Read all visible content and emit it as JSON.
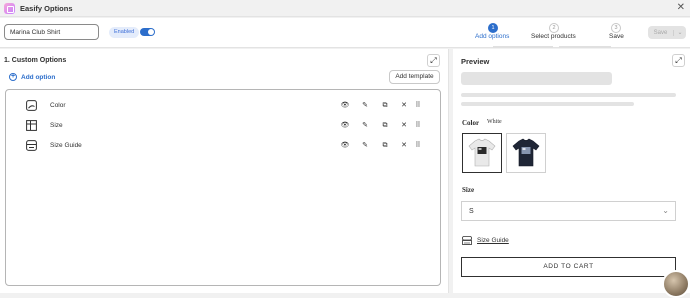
{
  "window": {
    "title": "Easify Options",
    "close_icon": "close-icon"
  },
  "header": {
    "name_value": "Marina Club Shirt",
    "enabled_label": "Enabled",
    "toggle_on": true,
    "steps": [
      {
        "number": "1",
        "label": "Add options",
        "active": true
      },
      {
        "number": "2",
        "label": "Select products",
        "active": false
      },
      {
        "number": "3",
        "label": "Save",
        "active": false
      }
    ],
    "save_label": "Save"
  },
  "options_panel": {
    "title": "1. Custom Options",
    "add_option_label": "Add option",
    "add_template_label": "Add template",
    "options": [
      {
        "label": "Color",
        "icon": "swatch-icon"
      },
      {
        "label": "Size",
        "icon": "table-icon"
      },
      {
        "label": "Size Guide",
        "icon": "size-guide-icon"
      }
    ]
  },
  "preview": {
    "title": "Preview",
    "color_label": "Color",
    "color_value": "White",
    "swatches": [
      "white",
      "navy"
    ],
    "size_label": "Size",
    "size_value": "S",
    "size_guide_label": "Size Guide",
    "add_to_cart_label": "ADD TO CART"
  },
  "colors": {
    "accent": "#2c6ecb",
    "border": "#b5b5b5"
  }
}
